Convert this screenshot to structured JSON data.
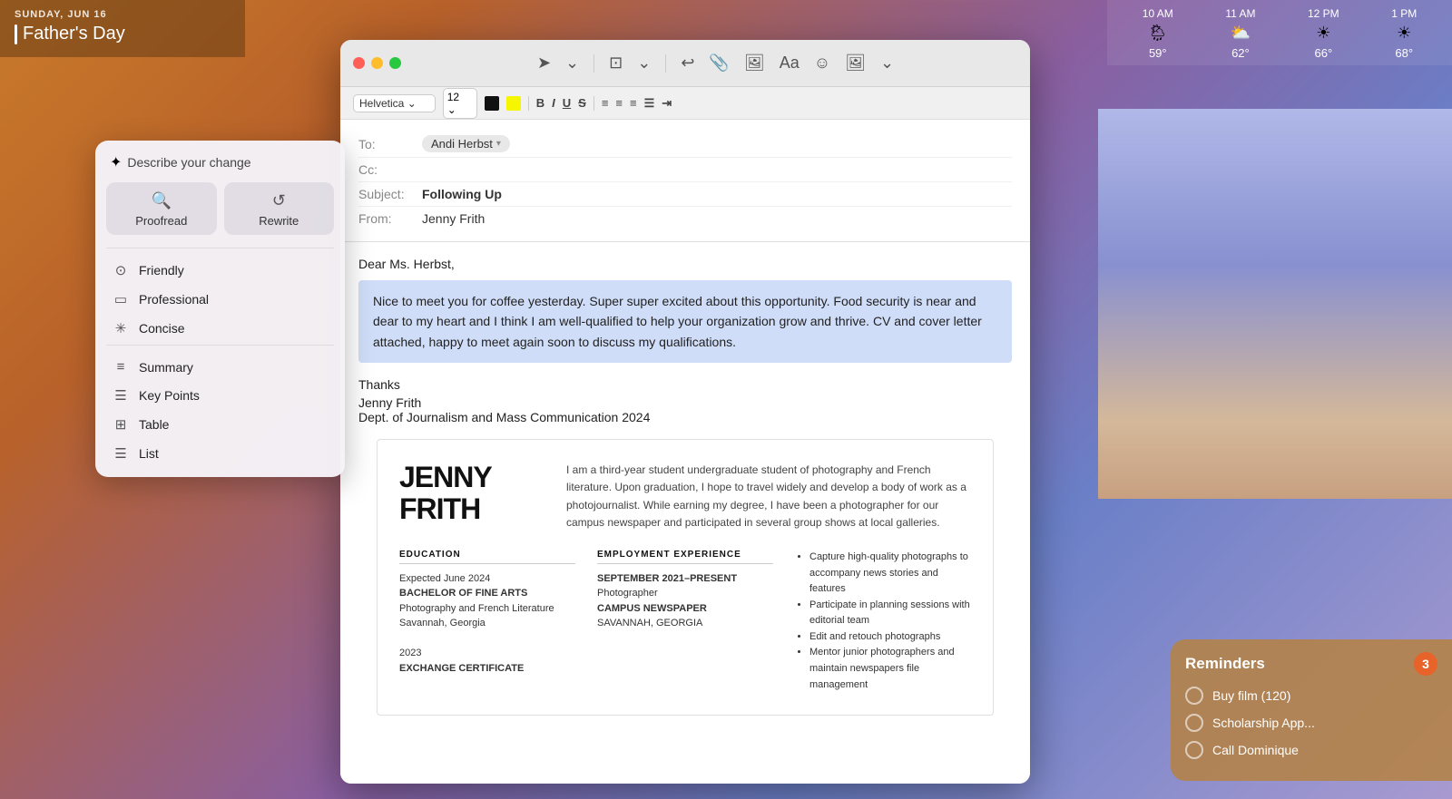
{
  "desktop": {
    "bg_color": "#c97a2a"
  },
  "calendar": {
    "day_label": "SUNDAY, JUN 16",
    "event_name": "Father's Day"
  },
  "weather": {
    "hours": [
      {
        "time": "10 AM",
        "icon": "🌦",
        "temp": "59°"
      },
      {
        "time": "11 AM",
        "icon": "⛅",
        "temp": "62°"
      },
      {
        "time": "12 PM",
        "icon": "☀",
        "temp": "66°"
      },
      {
        "time": "1 PM",
        "icon": "☀",
        "temp": "68°"
      }
    ]
  },
  "reminders": {
    "title": "Reminders",
    "count": "3",
    "items": [
      {
        "text": "Buy film (120)"
      },
      {
        "text": "Scholarship App..."
      },
      {
        "text": "Call Dominique"
      }
    ]
  },
  "writing_tools": {
    "header": "Describe your change",
    "proofread_label": "Proofread",
    "rewrite_label": "Rewrite",
    "tools": [
      {
        "icon": "⊙",
        "label": "Friendly"
      },
      {
        "icon": "▭",
        "label": "Professional"
      },
      {
        "icon": "✳",
        "label": "Concise"
      },
      {
        "icon": "≡",
        "label": "Summary"
      },
      {
        "icon": "☰",
        "label": "Key Points"
      },
      {
        "icon": "⊞",
        "label": "Table"
      },
      {
        "icon": "☰",
        "label": "List"
      }
    ]
  },
  "mail": {
    "window_title": "Following Up",
    "to_field_label": "To:",
    "to_value": "Andi Herbst",
    "cc_field_label": "Cc:",
    "subject_field_label": "Subject:",
    "subject_value": "Following Up",
    "from_field_label": "From:",
    "from_value": "Jenny Frith",
    "font_name": "Helvetica",
    "font_size": "12",
    "greeting": "Dear Ms. Herbst,",
    "body_selected": "Nice to meet you for coffee yesterday. Super super excited about this opportunity. Food security is near and dear to my heart and I think I am well-qualified to help your organization grow and thrive. CV and cover letter attached, happy to meet again soon to discuss my qualifications.",
    "closing": "Thanks",
    "signature_name": "Jenny Frith",
    "signature_dept": "Dept. of Journalism and Mass Communication 2024",
    "cv_name_line1": "JENNY",
    "cv_name_line2": "FRITH",
    "cv_bio": "I am a third-year student undergraduate student of photography and French literature. Upon graduation, I hope to travel widely and develop a body of work as a photojournalist. While earning my degree, I have been a photographer for our campus newspaper and participated in several group shows at local galleries.",
    "cv_education_title": "EDUCATION",
    "cv_education_1_date": "Expected June 2024",
    "cv_education_1_degree": "BACHELOR OF FINE ARTS",
    "cv_education_1_major": "Photography and French Literature",
    "cv_education_1_school": "Savannah, Georgia",
    "cv_education_2_date": "2023",
    "cv_education_2_degree": "EXCHANGE CERTIFICATE",
    "cv_employment_title": "EMPLOYMENT EXPERIENCE",
    "cv_employment_date": "SEPTEMBER 2021–PRESENT",
    "cv_employment_role": "Photographer",
    "cv_employment_org": "CAMPUS NEWSPAPER",
    "cv_employment_location": "SAVANNAH, GEORGIA",
    "cv_bullets": [
      "Capture high-quality photographs to accompany news stories and features",
      "Participate in planning sessions with editorial team",
      "Edit and retouch photographs",
      "Mentor junior photographers and maintain newspapers file management"
    ]
  }
}
